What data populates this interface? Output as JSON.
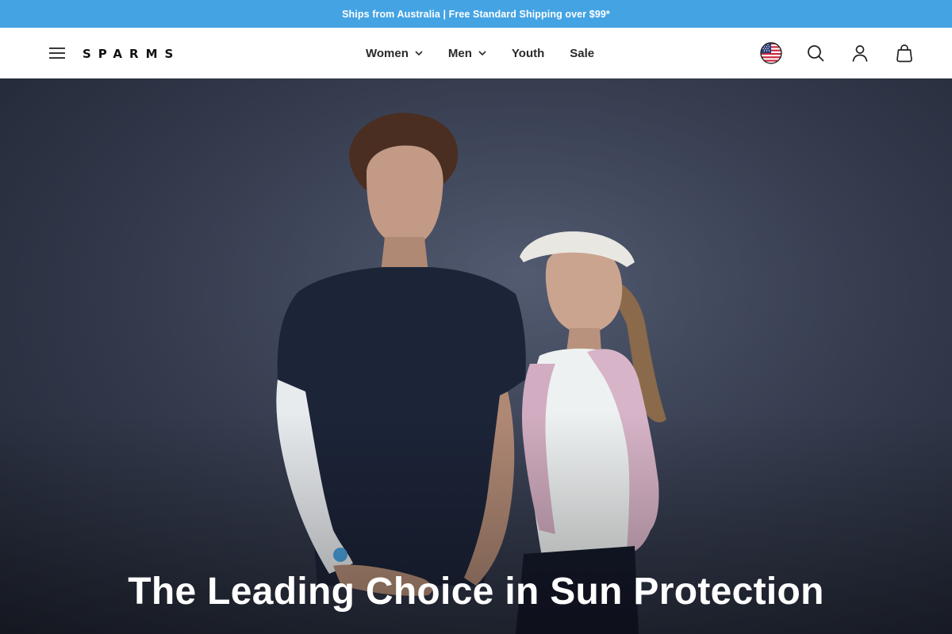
{
  "announcement": {
    "text": "Ships from Australia | Free Standard Shipping over $99*"
  },
  "header": {
    "menu_icon": "hamburger-icon",
    "logo": "SPARMS",
    "nav": [
      {
        "label": "Women",
        "has_dropdown": true
      },
      {
        "label": "Men",
        "has_dropdown": true
      },
      {
        "label": "Youth",
        "has_dropdown": false
      },
      {
        "label": "Sale",
        "has_dropdown": false
      }
    ],
    "icons": [
      "us-flag-icon",
      "search-icon",
      "account-icon",
      "shopping-bag-icon"
    ]
  },
  "hero": {
    "title": "The Leading Choice in Sun Protection",
    "image": "man in navy t-shirt and white arm sleeves beside woman in white visor and pink arm sleeves"
  },
  "colors": {
    "announcement_bg": "#44a3e3",
    "header_bg": "#ffffff",
    "hero_bg": "#3a4154",
    "text_dark": "#1a1a1a",
    "hero_text": "#ffffff"
  }
}
